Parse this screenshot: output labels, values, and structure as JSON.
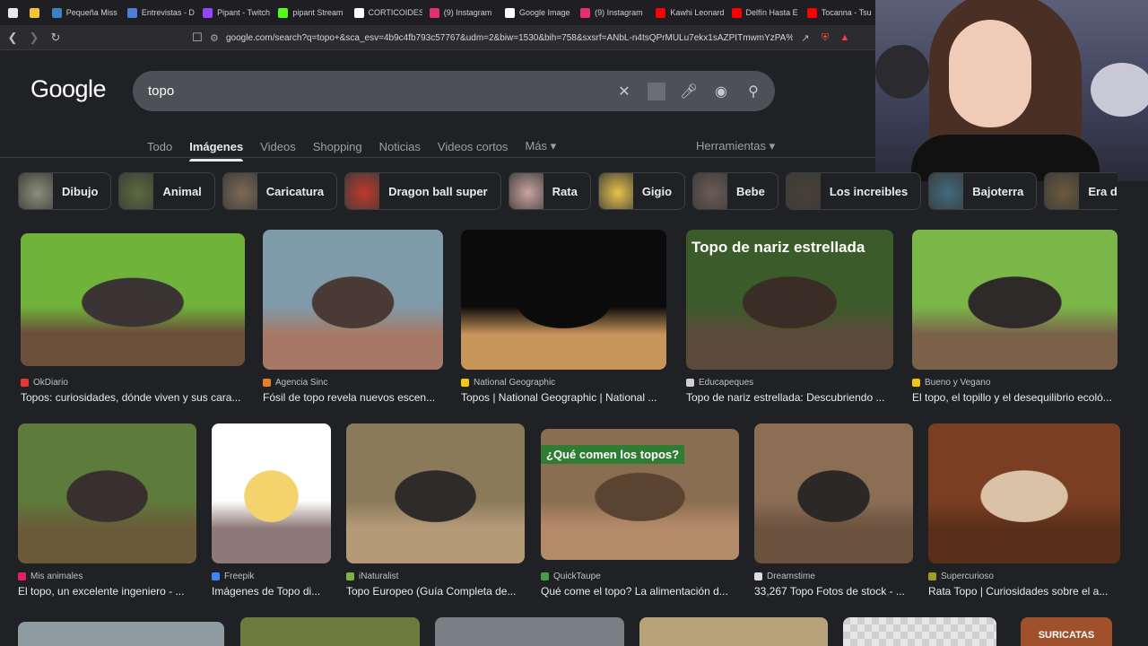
{
  "browser": {
    "tabs": [
      {
        "label": "",
        "color": "#e8e8e8",
        "pinned": true
      },
      {
        "label": "",
        "color": "#f2c531",
        "pinned": true
      },
      {
        "label": "Pequeña Miss",
        "color": "#3b82c4"
      },
      {
        "label": "Entrevistas - D",
        "color": "#4a7fd9"
      },
      {
        "label": "Pipant - Twitch",
        "color": "#9146ff"
      },
      {
        "label": "pipant Stream",
        "color": "#53fc18"
      },
      {
        "label": "CORTICOIDES",
        "color": "#ffffff"
      },
      {
        "label": "(9) Instagram",
        "color": "#e1306c"
      },
      {
        "label": "Google Image",
        "color": "#ffffff"
      },
      {
        "label": "(9) Instagram",
        "color": "#e1306c"
      },
      {
        "label": "Kawhi Leonard",
        "color": "#ff0000"
      },
      {
        "label": "Delfín Hasta E",
        "color": "#ff0000"
      },
      {
        "label": "Tocanna - Tsu",
        "color": "#ff0000"
      }
    ],
    "url": "google.com/search?q=topo+&sca_esv=4b9c4fb793c57767&udm=2&biw=1530&bih=758&sxsrf=ANbL-n4tsQPrMULu7ekx1sAZPITmwmYzPA%3A17..."
  },
  "google": {
    "logo": "Google",
    "query": "topo",
    "tabs": [
      "Todo",
      "Imágenes",
      "Videos",
      "Shopping",
      "Noticias",
      "Videos cortos",
      "Más ▾"
    ],
    "active_tab": "Imágenes",
    "tools": "Herramientas ▾"
  },
  "chips": [
    {
      "label": "Dibujo",
      "color": "#8a8f7a"
    },
    {
      "label": "Animal",
      "color": "#5d6b3e"
    },
    {
      "label": "Caricatura",
      "color": "#7d6a55"
    },
    {
      "label": "Dragon ball super",
      "color": "#c0392b"
    },
    {
      "label": "Rata",
      "color": "#c9a3a0"
    },
    {
      "label": "Gigio",
      "color": "#e8c24a"
    },
    {
      "label": "Bebe",
      "color": "#6d5c55"
    },
    {
      "label": "Los increibles",
      "color": "#4a4036"
    },
    {
      "label": "Bajoterra",
      "color": "#3f6b7f"
    },
    {
      "label": "Era de hielo",
      "color": "#6b5a3c"
    },
    {
      "label": "",
      "color": "#7a5535"
    }
  ],
  "results": [
    {
      "source": "OkDiario",
      "title": "Topos: curiosidades, dónde viven y sus cara...",
      "fav": "#e53935",
      "colors": [
        "#6fb33a",
        "#3b3434",
        "#6b4f3a"
      ]
    },
    {
      "source": "Agencia Sinc",
      "title": "Fósil de topo revela nuevos escen...",
      "fav": "#e67e22",
      "colors": [
        "#7f9aa8",
        "#4a3a36",
        "#a87866"
      ]
    },
    {
      "source": "National Geographic",
      "title": "Topos | National Geographic | National ...",
      "fav": "#f5c518",
      "colors": [
        "#0b0b0b",
        "#0b0b0b",
        "#c8955a"
      ]
    },
    {
      "source": "Educapeques",
      "title": "Topo de nariz estrellada: Descubriendo ...",
      "fav": "#d0d0d0",
      "colors": [
        "#3c5b2a",
        "#3a2d26",
        "#5b4a3a"
      ],
      "overlay": "Topo de nariz estrellada"
    },
    {
      "source": "Bueno y Vegano",
      "title": "El topo, el topillo y el desequilibrio ecoló...",
      "fav": "#f1c40f",
      "colors": [
        "#7ab648",
        "#2e2a2a",
        "#7b604a"
      ]
    },
    {
      "source": "Mis animales",
      "title": "El topo, un excelente ingeniero - ...",
      "fav": "#e91e63",
      "colors": [
        "#5d7b3a",
        "#3a2f2f",
        "#6a5a3a"
      ]
    },
    {
      "source": "Freepik",
      "title": "Imágenes de Topo di...",
      "fav": "#4285f4",
      "colors": [
        "#ffffff",
        "#f3d36b",
        "#8d7a78"
      ]
    },
    {
      "source": "iNaturalist",
      "title": "Topo Europeo (Guía Completa de...",
      "fav": "#7cb342",
      "colors": [
        "#8a7a5a",
        "#2f2b2a",
        "#b59a78"
      ]
    },
    {
      "source": "QuickTaupe",
      "title": "Qué come el topo? La alimentación d...",
      "fav": "#43a047",
      "colors": [
        "#8a6e52",
        "#5b4332",
        "#b48b68"
      ],
      "overlay": "¿Qué comen los topos?"
    },
    {
      "source": "Dreamstime",
      "title": "33,267 Topo Fotos de stock - ...",
      "fav": "#dddddd",
      "colors": [
        "#8b6e54",
        "#2c2828",
        "#6a523f"
      ]
    },
    {
      "source": "Supercurioso",
      "title": "Rata Topo | Curiosidades sobre el a...",
      "fav": "#9e9d24",
      "colors": [
        "#7a3e22",
        "#d9c2a6",
        "#5a2f1a"
      ]
    }
  ],
  "row3_colors": [
    "#8f9aa1",
    "#6d7a3d",
    "#7a7f84",
    "#b8a27a",
    "#d7d7d7",
    "#a0512c"
  ],
  "row3_overlay": "SURICATAS"
}
